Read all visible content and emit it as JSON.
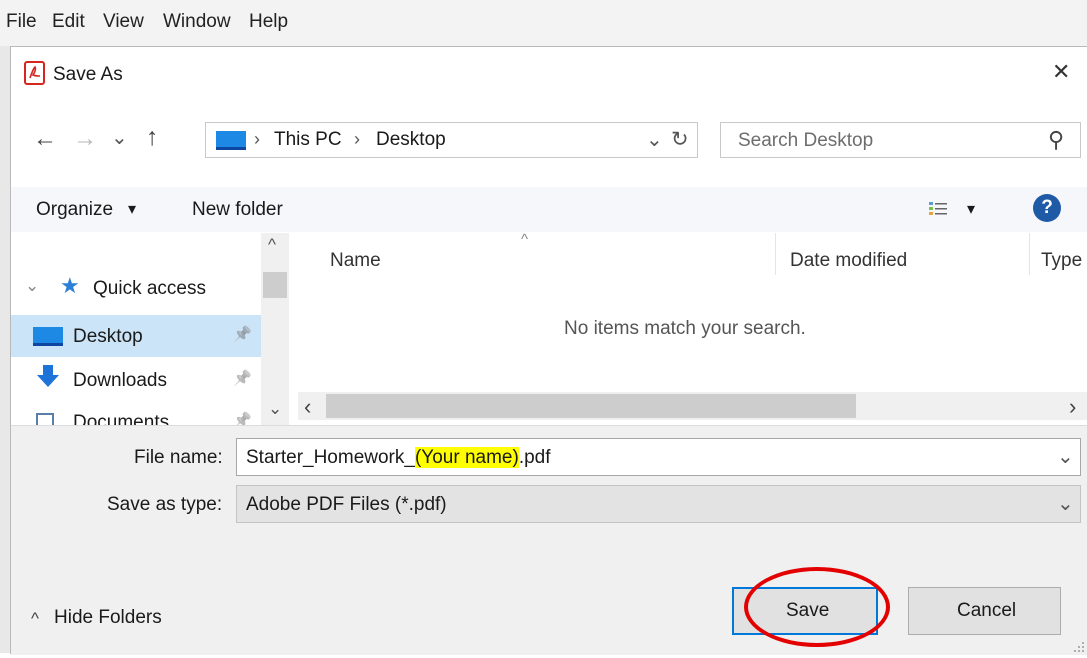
{
  "menu": {
    "file": "File",
    "edit": "Edit",
    "view": "View",
    "window": "Window",
    "help": "Help"
  },
  "dialog": {
    "title": "Save As",
    "close_glyph": "✕"
  },
  "nav": {
    "back_glyph": "←",
    "forward_glyph": "→",
    "recent_glyph": "⌄",
    "up_glyph": "↑",
    "breadcrumb": [
      "This PC",
      "Desktop"
    ],
    "breadcrumb_sep": "›",
    "refresh_glyph": "↻",
    "dropdown_glyph": "⌄"
  },
  "search": {
    "placeholder": "Search Desktop",
    "icon_glyph": "⚲"
  },
  "toolbar": {
    "organize": "Organize",
    "organize_caret": "▾",
    "new_folder": "New folder",
    "view_caret": "▾",
    "help_glyph": "?"
  },
  "navpane": {
    "quick_access": "Quick access",
    "items": [
      {
        "label": "Desktop",
        "pin": "📌"
      },
      {
        "label": "Downloads",
        "pin": "📌"
      },
      {
        "label": "Documents",
        "pin": "📌"
      }
    ],
    "expand_glyph": "⌄"
  },
  "columns": {
    "name": "Name",
    "date_modified": "Date modified",
    "type": "Type",
    "sort_glyph": "^"
  },
  "list": {
    "empty_message": "No items match your search."
  },
  "scroll": {
    "up": "^",
    "down": "⌄",
    "left": "‹",
    "right": "›"
  },
  "form": {
    "file_name_label": "File name:",
    "file_name_prefix": "Starter_Homework_",
    "file_name_highlight": "(Your name)",
    "file_name_suffix": ".pdf",
    "save_as_type_label": "Save as type:",
    "save_as_type_value": "Adobe PDF Files (*.pdf)",
    "dropdown_glyph": "⌄"
  },
  "footer": {
    "hide_folders_glyph": "^",
    "hide_folders": "Hide Folders",
    "save": "Save",
    "cancel": "Cancel"
  },
  "colors": {
    "accent": "#0078d7",
    "highlight": "#ffff00",
    "annotation_ring": "#e30000",
    "selection": "#cce4f7",
    "pdf_red": "#d6271e",
    "help_blue": "#1f5aa6"
  }
}
